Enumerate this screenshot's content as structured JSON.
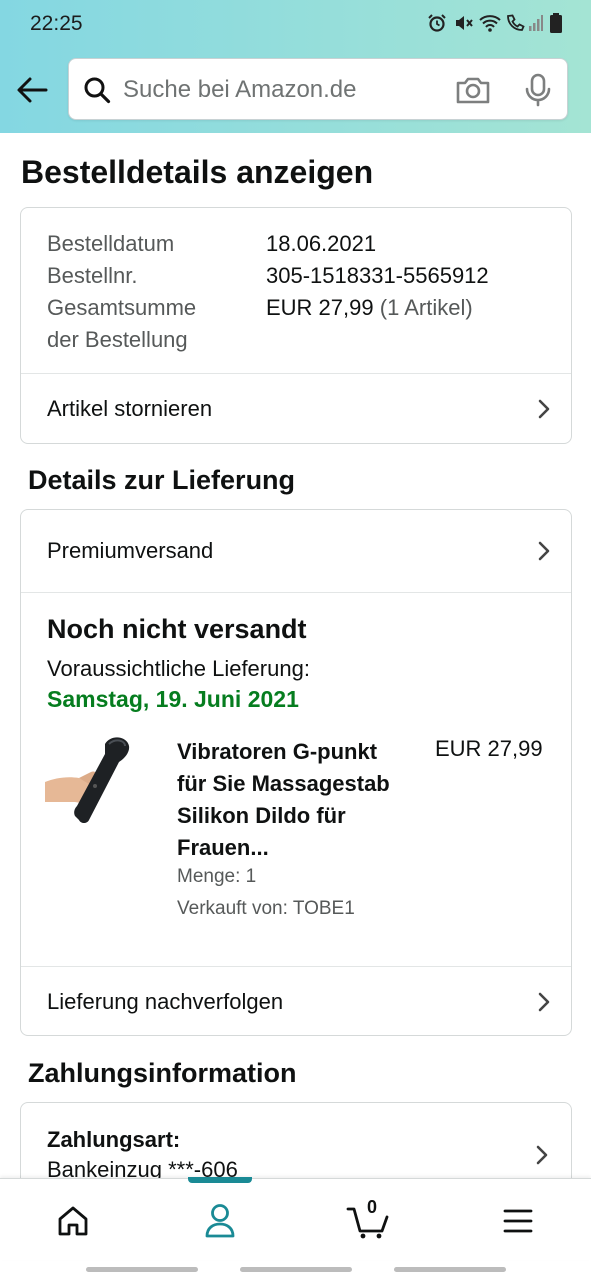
{
  "status_bar": {
    "time": "22:25"
  },
  "search": {
    "placeholder": "Suche bei Amazon.de"
  },
  "page": {
    "title": "Bestelldetails anzeigen"
  },
  "order_summary": {
    "rows": [
      {
        "label": "Bestelldatum",
        "value": "18.06.2021",
        "extra": ""
      },
      {
        "label": "Bestellnr.",
        "value": "305-1518331-5565912",
        "extra": ""
      },
      {
        "label": "Gesamtsumme",
        "label2": "der Bestellung",
        "value": "EUR 27,99",
        "extra": "(1 Artikel)"
      }
    ],
    "cancel_label": "Artikel stornieren"
  },
  "delivery": {
    "heading": "Details zur Lieferung",
    "shipping_method": "Premiumversand",
    "status": "Noch nicht versandt",
    "expected_label": "Voraussichtliche Lieferung:",
    "expected_date": "Samstag, 19. Juni 2021",
    "colors": {
      "date": "#067d1f"
    },
    "item": {
      "title_lines": [
        "Vibratoren G-punkt",
        "für Sie Massagestab",
        "Silikon Dildo für",
        "Frauen..."
      ],
      "price": "EUR 27,99",
      "quantity": "Menge: 1",
      "seller": "Verkauft von: TOBE1"
    },
    "track_label": "Lieferung nachverfolgen"
  },
  "payment": {
    "heading": "Zahlungsinformation",
    "type_label": "Zahlungsart:",
    "type_value": "Bankeinzug ***-606"
  },
  "bottom_nav": {
    "cart_count": "0",
    "active_tab": "account",
    "accent": "#1a8a95"
  }
}
